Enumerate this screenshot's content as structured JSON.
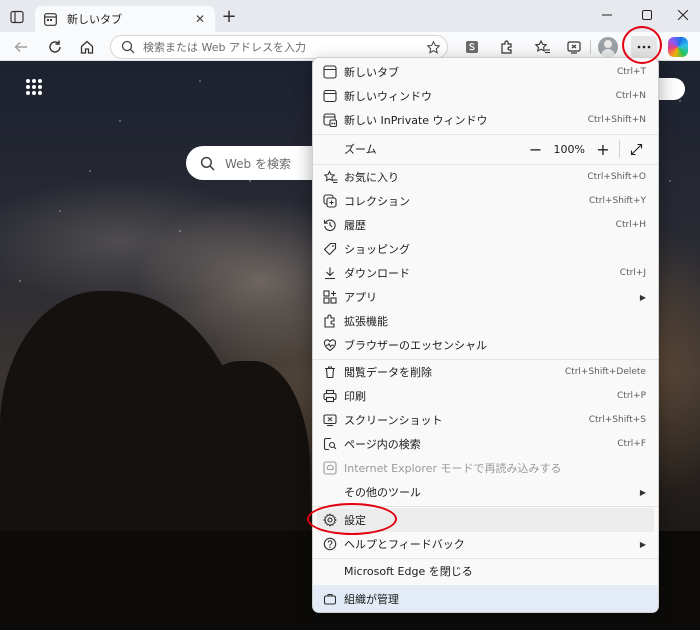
{
  "tab": {
    "title": "新しいタブ",
    "close_glyph": "✕"
  },
  "newtab_glyph": "+",
  "addressbar": {
    "placeholder": "検索または Web アドレスを入力"
  },
  "newtab_page": {
    "search_placeholder": "Web を検索"
  },
  "menu": {
    "items": [
      {
        "label": "新しいタブ",
        "shortcut": "Ctrl+T",
        "icon": "new-tab-icon"
      },
      {
        "label": "新しいウィンドウ",
        "shortcut": "Ctrl+N",
        "icon": "new-window-icon"
      },
      {
        "label": "新しい InPrivate ウィンドウ",
        "shortcut": "Ctrl+Shift+N",
        "icon": "inprivate-icon"
      },
      {
        "label": "ズーム",
        "icon": "none"
      },
      {
        "label": "お気に入り",
        "shortcut": "Ctrl+Shift+O",
        "icon": "favorites-icon"
      },
      {
        "label": "コレクション",
        "shortcut": "Ctrl+Shift+Y",
        "icon": "collections-icon"
      },
      {
        "label": "履歴",
        "shortcut": "Ctrl+H",
        "icon": "history-icon"
      },
      {
        "label": "ショッピング",
        "icon": "shopping-tag-icon"
      },
      {
        "label": "ダウンロード",
        "shortcut": "Ctrl+J",
        "icon": "download-icon"
      },
      {
        "label": "アプリ",
        "icon": "apps-icon"
      },
      {
        "label": "拡張機能",
        "icon": "extensions-icon"
      },
      {
        "label": "ブラウザーのエッセンシャル",
        "icon": "essentials-heart-icon"
      },
      {
        "label": "閲覧データを削除",
        "shortcut": "Ctrl+Shift+Delete",
        "icon": "trash-icon"
      },
      {
        "label": "印刷",
        "shortcut": "Ctrl+P",
        "icon": "printer-icon"
      },
      {
        "label": "スクリーンショット",
        "shortcut": "Ctrl+Shift+S",
        "icon": "screenshot-icon"
      },
      {
        "label": "ページ内の検索",
        "shortcut": "Ctrl+F",
        "icon": "find-in-page-icon"
      },
      {
        "label": "Internet Explorer モードで再読み込みする",
        "icon": "ie-mode-icon"
      },
      {
        "label": "その他のツール",
        "icon": "none"
      },
      {
        "label": "設定",
        "icon": "gear-icon"
      },
      {
        "label": "ヘルプとフィードバック",
        "icon": "help-icon"
      },
      {
        "label": "Microsoft Edge を閉じる",
        "icon": "none"
      },
      {
        "label": "組織が管理",
        "icon": "briefcase-icon"
      }
    ],
    "zoom": {
      "minus": "−",
      "value": "100%",
      "plus": "+"
    },
    "submenu_arrow": "▶"
  },
  "accent": {
    "highlight_ring": "#e3000f",
    "managed_bg": "#e3ecf6"
  }
}
